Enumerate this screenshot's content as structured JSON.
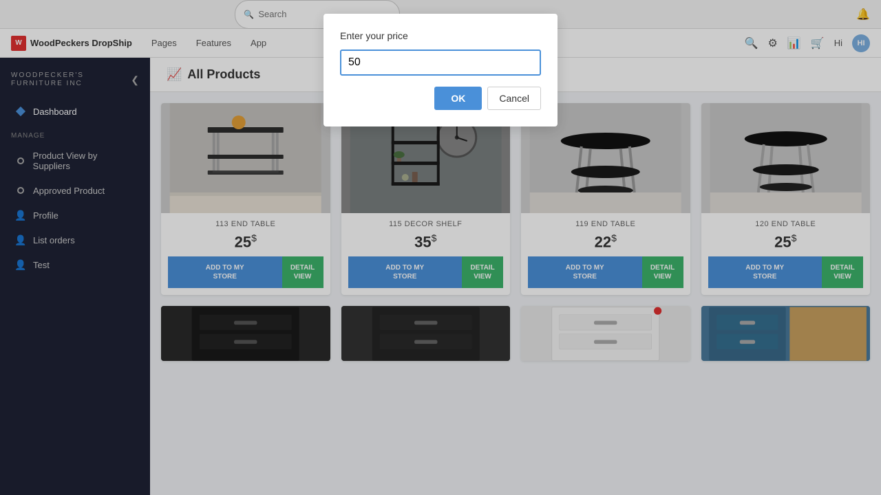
{
  "browser": {
    "search_placeholder": "Search",
    "bell_icon": "🔔"
  },
  "topbar": {
    "logo_text": "WoodPeckers DropShip",
    "logo_initial": "W",
    "tabs": [
      {
        "label": "Pages"
      },
      {
        "label": "Features"
      },
      {
        "label": "App"
      }
    ],
    "hi_label": "Hi",
    "avatar_initials": "HI"
  },
  "sidebar": {
    "brand_line1": "WOODPECKER'S",
    "brand_line2": "FURNITURE INC",
    "collapse_icon": "❮",
    "manage_label": "MANAGE",
    "items": [
      {
        "label": "Dashboard",
        "icon": "diamond",
        "active": true
      },
      {
        "label": "Product View by Suppliers",
        "icon": "circle"
      },
      {
        "label": "Approved Product",
        "icon": "circle"
      },
      {
        "label": "Profile",
        "icon": "person"
      },
      {
        "label": "List orders",
        "icon": "person"
      },
      {
        "label": "Test",
        "icon": "person"
      }
    ]
  },
  "page": {
    "title": "All Products",
    "chart_icon": "📈"
  },
  "products": [
    {
      "name": "113 END TABLE",
      "price": "25",
      "currency": "$",
      "add_label": "ADD TO MY\nSTORE",
      "detail_label": "DETAIL\nVIEW",
      "bg": "#b8b8b8",
      "shape": "end-table-1"
    },
    {
      "name": "115 DECOR SHELF",
      "price": "35",
      "currency": "$",
      "add_label": "ADD TO MY\nSTORE",
      "detail_label": "DETAIL\nVIEW",
      "bg": "#999",
      "shape": "shelf"
    },
    {
      "name": "119 END TABLE",
      "price": "22",
      "currency": "$",
      "add_label": "ADD TO MY\nSTORE",
      "detail_label": "DETAIL\nVIEW",
      "bg": "#c0c0c0",
      "shape": "end-table-2"
    },
    {
      "name": "120 END TABLE",
      "price": "25",
      "currency": "$",
      "add_label": "ADD TO MY\nSTORE",
      "detail_label": "DETAIL\nVIEW",
      "bg": "#c0c0c0",
      "shape": "end-table-3"
    }
  ],
  "bottom_products": [
    {
      "bg": "#222",
      "shape": "dark-dresser"
    },
    {
      "bg": "#333",
      "shape": "dark-dresser-2"
    },
    {
      "bg": "#eee",
      "shape": "white-dresser"
    },
    {
      "bg": "#4a7a9b",
      "shape": "teal-dresser"
    }
  ],
  "modal": {
    "label": "Enter your price",
    "input_value": "50",
    "ok_label": "OK",
    "cancel_label": "Cancel"
  }
}
